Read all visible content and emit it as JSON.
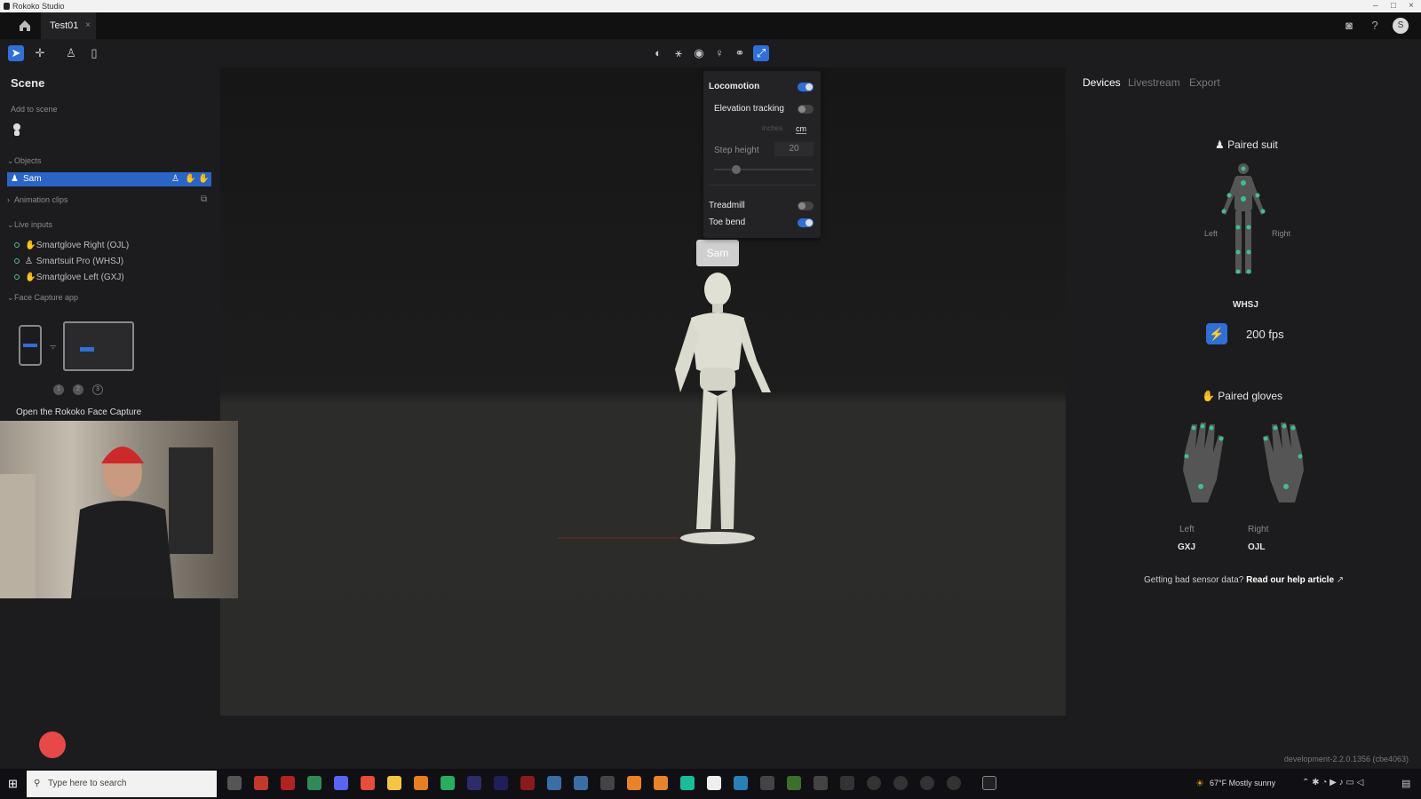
{
  "window": {
    "title": "Rokoko Studio"
  },
  "tabs": [
    {
      "label": "Test01",
      "close": "×"
    }
  ],
  "user": {
    "initial": "S"
  },
  "left_panel": {
    "title": "Scene",
    "add_to_scene": "Add to scene",
    "objects_header": "Objects",
    "object_row": "Sam",
    "animation_clips_header": "Animation clips",
    "live_inputs_header": "Live inputs",
    "live_inputs": [
      "Smartglove Right (OJL)",
      "Smartsuit Pro (WHSJ)",
      "Smartglove Left (GXJ)"
    ],
    "face_capture_header": "Face Capture app",
    "steps": [
      "1",
      "2",
      "3"
    ],
    "face_capture_text": "Open the Rokoko Face Capture"
  },
  "locomotion_popup": {
    "title": "Locomotion",
    "elevation_tracking": "Elevation tracking",
    "unit_inches": "inches",
    "unit_cm": "cm",
    "step_height_label": "Step height",
    "step_height_value": "20",
    "treadmill": "Treadmill",
    "toe_bend": "Toe bend",
    "locomotion_on": true,
    "elevation_on": false,
    "treadmill_on": false,
    "toe_bend_on": true
  },
  "viewport": {
    "actor_name": "Sam"
  },
  "right_panel": {
    "tabs": [
      "Devices",
      "Livestream",
      "Export"
    ],
    "paired_suit": "Paired suit",
    "suit_left": "Left",
    "suit_right": "Right",
    "suit_id": "WHSJ",
    "fps": "200 fps",
    "paired_gloves": "Paired gloves",
    "glove_left_label": "Left",
    "glove_right_label": "Right",
    "glove_left_id": "GXJ",
    "glove_right_id": "OJL",
    "help_prefix": "Getting bad sensor data?",
    "help_link": "Read our help article"
  },
  "version": "development-2.2.0.1356 (cbe4063)",
  "taskbar": {
    "search_placeholder": "Type here to search",
    "weather": "67°F  Mostly sunny"
  },
  "colors": {
    "accent": "#2f6fd6",
    "record": "#e74848",
    "sensor": "#3fbf8f"
  }
}
